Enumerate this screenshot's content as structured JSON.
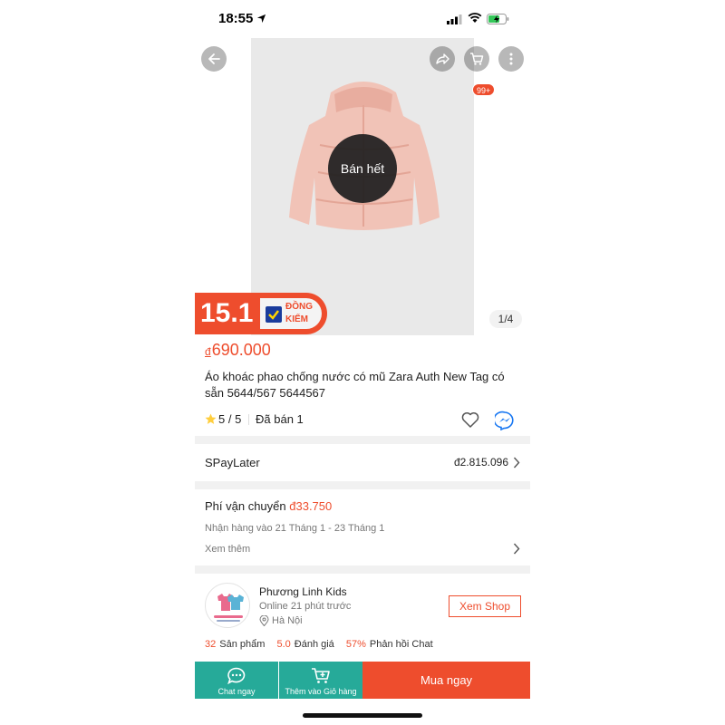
{
  "status_bar": {
    "time": "18:55"
  },
  "product": {
    "sold_out_label": "Bán hết",
    "cart_badge": "99+",
    "promo_number": "15.1",
    "promo_tag_line1": "ĐỒNG",
    "promo_tag_line2": "KIỂM",
    "image_pager": "1/4",
    "currency_symbol": "đ",
    "price": "690.000",
    "title": "Áo khoác phao chống nước có mũ Zara Auth New Tag có sẵn 5644/567 5644567",
    "rating": "5 / 5",
    "sold": "Đã bán 1"
  },
  "spaylater": {
    "label": "SPayLater",
    "value": "đ2.815.096"
  },
  "shipping": {
    "label": "Phí vận chuyển",
    "fee": "đ33.750",
    "eta": "Nhận hàng vào 21 Tháng 1 - 23 Tháng 1",
    "more": "Xem thêm"
  },
  "shop": {
    "name": "Phương Linh Kids",
    "online": "Online 21 phút trước",
    "location": "Hà Nội",
    "view_button": "Xem Shop",
    "stats": [
      {
        "value": "32",
        "label": "Sản phẩm"
      },
      {
        "value": "5.0",
        "label": "Đánh giá"
      },
      {
        "value": "57%",
        "label": "Phản hồi Chat"
      }
    ]
  },
  "bottom_bar": {
    "chat_label": "Chat ngay",
    "cart_label": "Thêm vào Giỏ hàng",
    "buy_label": "Mua ngay"
  },
  "colors": {
    "accent": "#ee4d2d",
    "teal": "#26aa99"
  },
  "icons": [
    "location-arrow-icon",
    "signal-icon",
    "wifi-icon",
    "battery-icon",
    "back-icon",
    "share-icon",
    "cart-icon",
    "more-icon",
    "star-icon",
    "heart-icon",
    "messenger-icon",
    "chevron-right-icon",
    "pin-icon",
    "chat-icon",
    "add-cart-icon",
    "check-icon"
  ]
}
